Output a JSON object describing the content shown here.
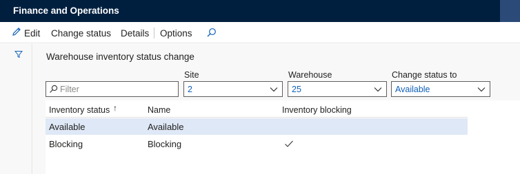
{
  "app": {
    "title": "Finance and Operations"
  },
  "toolbar": {
    "edit_label": "Edit",
    "change_status_label": "Change status",
    "details_label": "Details",
    "options_label": "Options"
  },
  "page": {
    "title": "Warehouse inventory status change"
  },
  "filters": {
    "search_placeholder": "Filter",
    "site": {
      "label": "Site",
      "value": "2"
    },
    "warehouse": {
      "label": "Warehouse",
      "value": "25"
    },
    "change_status_to": {
      "label": "Change status to",
      "value": "Available"
    }
  },
  "grid": {
    "columns": [
      "Inventory status",
      "Name",
      "Inventory blocking"
    ],
    "sort_indicator": "↑",
    "rows": [
      {
        "status": "Available",
        "name": "Available",
        "blocking": false,
        "selected": true
      },
      {
        "status": "Blocking",
        "name": "Blocking",
        "blocking": true,
        "selected": false
      }
    ]
  },
  "colors": {
    "topbar": "#001f3f",
    "accent": "#0f5fb8",
    "selected_row": "#dfe8f6"
  }
}
